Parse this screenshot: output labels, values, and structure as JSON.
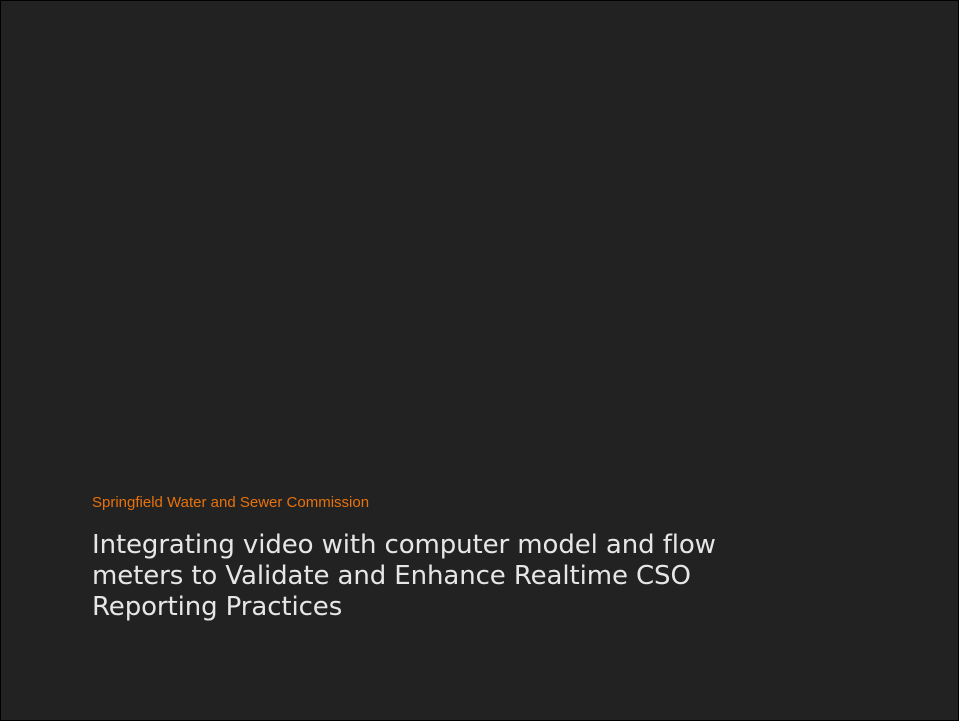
{
  "slide": {
    "subtitle": "Springfield Water and Sewer Commission",
    "title_lines": [
      "Integrating video with computer model and flow",
      "meters to Validate and Enhance Realtime CSO",
      "Reporting Practices"
    ]
  },
  "colors": {
    "background": "#222222",
    "subtitle": "#e8720c",
    "title": "#e6e6e6"
  }
}
